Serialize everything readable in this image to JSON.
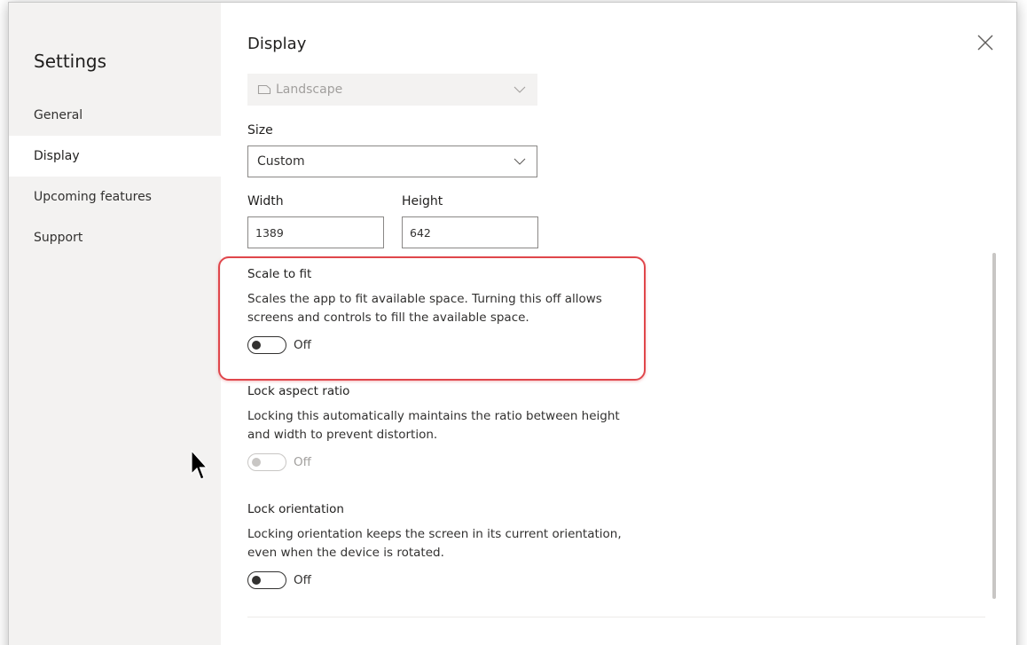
{
  "sidebar": {
    "title": "Settings",
    "items": [
      {
        "label": "General",
        "active": false
      },
      {
        "label": "Display",
        "active": true
      },
      {
        "label": "Upcoming features",
        "active": false
      },
      {
        "label": "Support",
        "active": false
      }
    ]
  },
  "content": {
    "section_title": "Display",
    "orientation": {
      "value": "Landscape",
      "icon": "page-landscape-icon",
      "disabled": true
    },
    "size": {
      "label": "Size",
      "value": "Custom"
    },
    "width": {
      "label": "Width",
      "value": "1389"
    },
    "height": {
      "label": "Height",
      "value": "642"
    },
    "settings": {
      "scale_to_fit": {
        "title": "Scale to fit",
        "description": "Scales the app to fit available space. Turning this off allows screens and controls to fill the available space.",
        "state": "Off",
        "disabled": false,
        "highlighted": true
      },
      "lock_aspect_ratio": {
        "title": "Lock aspect ratio",
        "description": "Locking this automatically maintains the ratio between height and width to prevent distortion.",
        "state": "Off",
        "disabled": true
      },
      "lock_orientation": {
        "title": "Lock orientation",
        "description": "Locking orientation keeps the screen in its current orientation, even when the device is rotated.",
        "state": "Off",
        "disabled": false
      }
    }
  },
  "colors": {
    "sidebar_bg": "#f3f2f1",
    "highlight_border": "#e0474c",
    "text": "#201f1e"
  },
  "icons": {
    "close": "close-icon",
    "chevron": "chevron-down-icon",
    "cursor": "mouse-pointer-icon"
  }
}
